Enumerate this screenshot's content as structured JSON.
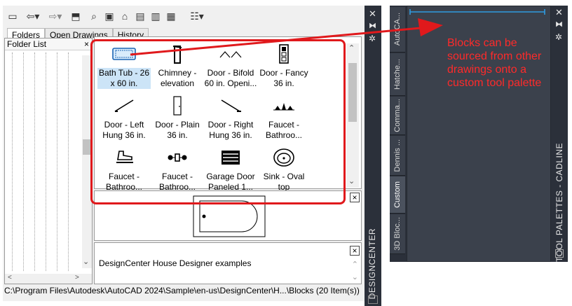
{
  "designcenter": {
    "tabs": [
      "Folders",
      "Open Drawings",
      "History"
    ],
    "folder_list_header": "Folder List",
    "close_glyph": "×",
    "items": [
      {
        "label": "Bath Tub - 26\nx 60 in.",
        "icon": "bathtub-icon",
        "selected": true
      },
      {
        "label": "Chimney -\nelevation",
        "icon": "chimney-icon"
      },
      {
        "label": "Door - Bifold\n60 in. Openi...",
        "icon": "bifold-door-icon"
      },
      {
        "label": "Door - Fancy\n36 in.",
        "icon": "fancy-door-icon"
      },
      {
        "label": "Door - Left\nHung 36 in.",
        "icon": "left-door-icon"
      },
      {
        "label": "Door - Plain\n36 in.",
        "icon": "plain-door-icon"
      },
      {
        "label": "Door - Right\nHung 36 in.",
        "icon": "right-door-icon"
      },
      {
        "label": "Faucet -\nBathroo...",
        "icon": "faucet-icon"
      },
      {
        "label": "Faucet -\nBathroo...",
        "icon": "faucet-icon"
      },
      {
        "label": "Faucet -\nBathroo...",
        "icon": "faucet-icon"
      },
      {
        "label": "Garage Door\nPaneled 1...",
        "icon": "garage-door-icon"
      },
      {
        "label": "Sink - Oval\ntop",
        "icon": "sink-icon"
      }
    ],
    "description": "DesignCenter House Designer examples",
    "status_path": "C:\\Program Files\\Autodesk\\AutoCAD 2024\\Sample\\en-us\\DesignCenter\\H...\\Blocks (20 Item(s))",
    "title_vertical": "DESIGNCENTER"
  },
  "tool_palette": {
    "tabs": [
      "AutoCA...",
      "Hatche...",
      "Comma...",
      "Dennis ...",
      "Custom",
      "3D Bloc..."
    ],
    "active_tab": "Custom",
    "title_vertical": "TOOL PALETTES - CADLINE"
  },
  "annotation": {
    "text": "Blocks can be sourced from other drawings onto a custom tool palette",
    "color": "#e0191c"
  }
}
